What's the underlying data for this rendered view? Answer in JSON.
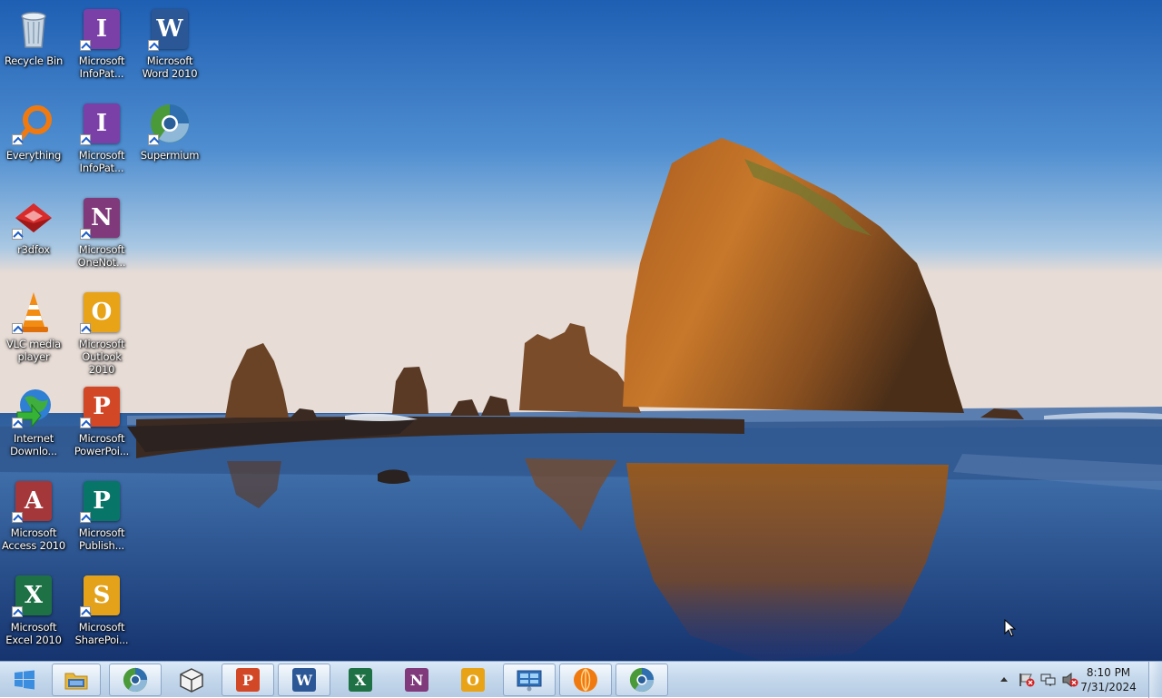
{
  "desktop": {
    "icons": [
      {
        "label": "Recycle Bin"
      },
      {
        "label": "Microsoft InfoPat..."
      },
      {
        "label": "Microsoft Word 2010"
      },
      {
        "label": "Everything"
      },
      {
        "label": "Microsoft InfoPat..."
      },
      {
        "label": "Supermium"
      },
      {
        "label": "r3dfox"
      },
      {
        "label": "Microsoft OneNot..."
      },
      {
        "label": "VLC media player"
      },
      {
        "label": "Microsoft Outlook 2010"
      },
      {
        "label": "Internet Downlo..."
      },
      {
        "label": "Microsoft PowerPoi..."
      },
      {
        "label": "Microsoft Access 2010"
      },
      {
        "label": "Microsoft Publish..."
      },
      {
        "label": "Microsoft Excel 2010"
      },
      {
        "label": "Microsoft SharePoi..."
      }
    ]
  },
  "taskbar": {
    "buttons": [
      {
        "icon": "windows-explorer-icon"
      },
      {
        "icon": "supermium-icon"
      },
      {
        "icon": "package-box-icon"
      },
      {
        "icon": "powerpoint-icon",
        "letter": "P"
      },
      {
        "icon": "word-icon",
        "letter": "W"
      },
      {
        "icon": "excel-icon",
        "letter": "X"
      },
      {
        "icon": "onenote-icon",
        "letter": "N"
      },
      {
        "icon": "outlook-icon",
        "letter": "O"
      },
      {
        "icon": "control-panel-icon"
      },
      {
        "icon": "firefox-orange-icon"
      },
      {
        "icon": "supermium-icon"
      }
    ],
    "tray": {
      "time": "8:10 PM",
      "date": "7/31/2024"
    }
  },
  "colors": {
    "word": "#2b5797",
    "infopath": "#7b3fa8",
    "onenote": "#80397b",
    "outlook": "#e8a317",
    "powerpoint": "#d24726",
    "access": "#a4373a",
    "publisher": "#077568",
    "excel": "#1e7145",
    "sharepoint": "#e3a21a"
  }
}
